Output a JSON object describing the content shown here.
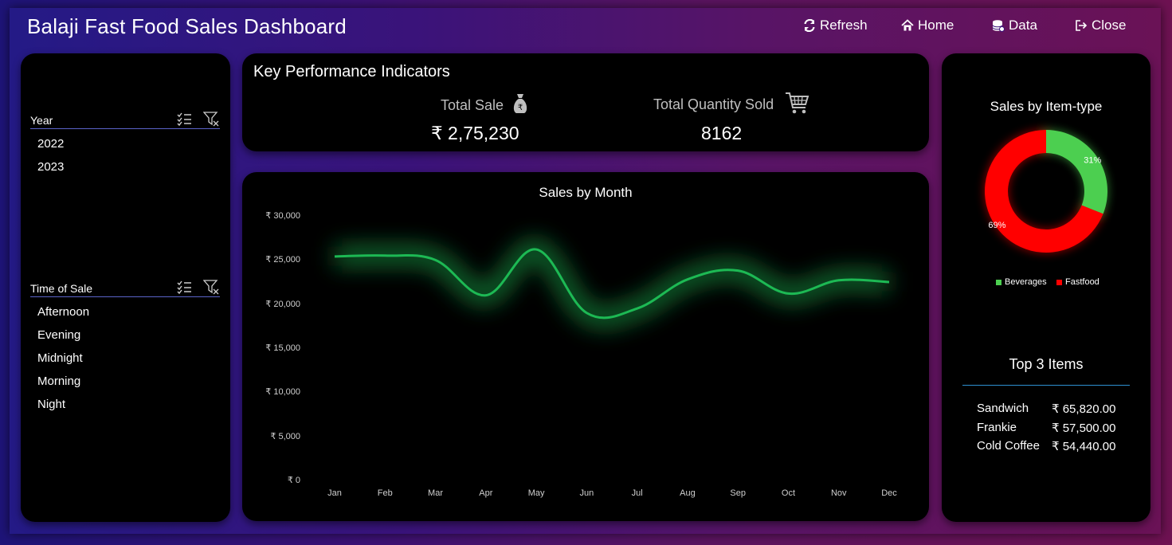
{
  "header": {
    "title": "Balaji Fast Food Sales Dashboard",
    "buttons": {
      "refresh": "Refresh",
      "home": "Home",
      "data": "Data",
      "close": "Close"
    }
  },
  "slicers": {
    "year": {
      "label": "Year",
      "items": [
        "2022",
        "2023"
      ]
    },
    "time_of_sale": {
      "label": "Time of Sale",
      "items": [
        "Afternoon",
        "Evening",
        "Midnight",
        "Morning",
        "Night"
      ]
    }
  },
  "kpi": {
    "title": "Key Performance Indicators",
    "total_sale_label": "Total Sale",
    "total_sale_value": "₹ 2,75,230",
    "total_qty_label": "Total Quantity Sold",
    "total_qty_value": "8162"
  },
  "colors": {
    "line": "#1db954",
    "beverages": "#4ccf50",
    "fastfood": "#ff0000"
  },
  "chart_data": [
    {
      "type": "line",
      "title": "Sales by Month",
      "categories": [
        "Jan",
        "Feb",
        "Mar",
        "Apr",
        "May",
        "Jun",
        "Jul",
        "Aug",
        "Sep",
        "Oct",
        "Nov",
        "Dec"
      ],
      "values": [
        25400,
        25500,
        25000,
        21000,
        26200,
        19000,
        19500,
        22800,
        23800,
        21200,
        22700,
        22500
      ],
      "ylim": [
        0,
        30000
      ],
      "yticks": [
        "₹ 30,000",
        "₹ 25,000",
        "₹ 20,000",
        "₹ 15,000",
        "₹ 10,000",
        "₹ 5,000",
        "₹ 0"
      ],
      "grid": false
    },
    {
      "type": "pie",
      "title": "Sales by Item-type",
      "labels": [
        "Beverages",
        "Fastfood"
      ],
      "values": [
        31,
        69
      ],
      "value_labels": [
        "31%",
        "69%"
      ],
      "legend": "bottom"
    }
  ],
  "top_items": {
    "title": "Top 3 Items",
    "rows": [
      {
        "name": "Sandwich",
        "value": "₹ 65,820.00"
      },
      {
        "name": "Frankie",
        "value": "₹ 57,500.00"
      },
      {
        "name": "Cold Coffee",
        "value": "₹ 54,440.00"
      }
    ]
  }
}
